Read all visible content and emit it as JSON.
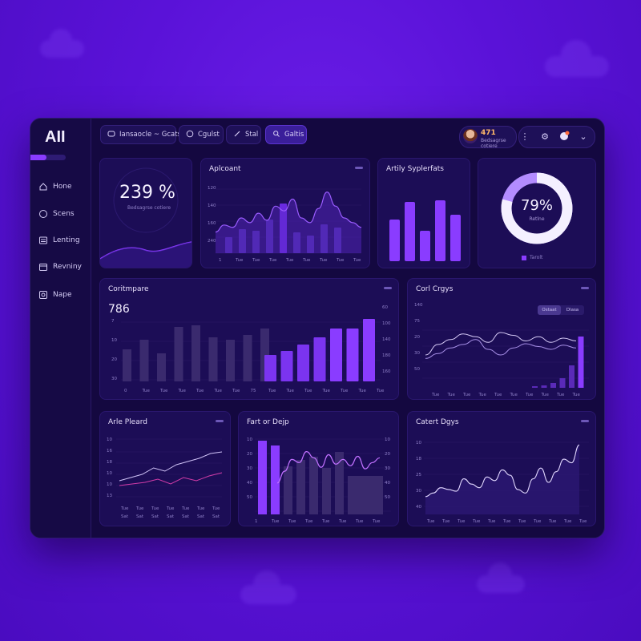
{
  "app": {
    "logo": "AII"
  },
  "sidebar": {
    "items": [
      {
        "label": "Hone",
        "icon": "home-icon"
      },
      {
        "label": "Scens",
        "icon": "chat-icon"
      },
      {
        "label": "Lenting",
        "icon": "list-icon"
      },
      {
        "label": "Revniny",
        "icon": "calendar-icon"
      },
      {
        "label": "Nape",
        "icon": "map-icon"
      }
    ]
  },
  "topbar": {
    "tabs": [
      {
        "label": "Iansaocle ~ Gcats",
        "icon": "layers-icon"
      },
      {
        "label": "Cgulst",
        "icon": "globe-icon"
      },
      {
        "label": "Stal",
        "icon": "pencil-icon"
      },
      {
        "label": "Galtis",
        "icon": "search-icon"
      }
    ],
    "profile": {
      "value": "471",
      "subtitle": "Bedsagrse cotiere"
    }
  },
  "cards": {
    "kpi": {
      "value": "239 %",
      "subtitle": "Bedsagrse cotiere"
    },
    "area": {
      "title": "Aplcoant"
    },
    "bars": {
      "title": "Artily Syplerfats"
    },
    "donut": {
      "value": "79%",
      "subtitle": "Retlne",
      "legend": "Tarolt"
    },
    "combo": {
      "title": "Coritmpare",
      "value": "786"
    },
    "lines": {
      "title": "Corl Crgys",
      "toggle": [
        "Ostaat",
        "Dlasa"
      ]
    },
    "small1": {
      "title": "Arle Pleard"
    },
    "small2": {
      "title": "Fart or Dejp"
    },
    "small3": {
      "title": "Catert Dgys"
    }
  },
  "colors": {
    "accent": "#8a3cff",
    "accent_light": "#b070ff",
    "bg": "#140840",
    "card": "#1c0d56",
    "muted_bar": "#3a2a6e"
  },
  "chart_data": [
    {
      "type": "area",
      "title": "Aplcoant",
      "x": [
        "1",
        "Tue",
        "Tue",
        "Tue",
        "Tue",
        "Tue",
        "Tue",
        "Tue",
        "Tue"
      ],
      "values": [
        18,
        24,
        22,
        30,
        26,
        34,
        28,
        40,
        36,
        46,
        30,
        26,
        38,
        52,
        40,
        30,
        26,
        22
      ],
      "bars": [
        20,
        30,
        28,
        42,
        62,
        26,
        22,
        36,
        32
      ],
      "yticks": [
        "120",
        "140",
        "160",
        "240"
      ]
    },
    {
      "type": "bar",
      "title": "Artily Syplerfats",
      "values": [
        52,
        74,
        38,
        76,
        58
      ]
    },
    {
      "type": "pie",
      "title": "79%",
      "values": [
        79,
        21
      ]
    },
    {
      "type": "bar",
      "title": "Coritmpare",
      "series": [
        {
          "values": [
            40,
            52,
            35,
            68,
            70,
            55,
            52,
            58,
            66
          ]
        },
        {
          "values": [
            33,
            38,
            46,
            55,
            66,
            66,
            78
          ]
        }
      ],
      "yticks": [
        "7",
        "10",
        "20",
        "30"
      ],
      "yticks_right": [
        "60",
        "100",
        "140",
        "180",
        "160"
      ]
    },
    {
      "type": "line",
      "title": "Corl Crgys",
      "series": [
        {
          "values": [
            40,
            55,
            62,
            70,
            66,
            58,
            72,
            68,
            60,
            66,
            58,
            64,
            60
          ]
        },
        {
          "values": [
            35,
            42,
            50,
            55,
            62,
            48,
            40,
            50,
            56,
            52,
            48,
            54,
            50
          ]
        }
      ],
      "bars": [
        2,
        3,
        6,
        12,
        28,
        64
      ],
      "yticks": [
        "140",
        "75",
        "20",
        "30",
        "50"
      ]
    },
    {
      "type": "line",
      "title": "Arle Pleard",
      "series": [
        {
          "values": [
            24,
            28,
            32,
            40,
            36,
            44,
            48,
            52,
            58,
            60
          ]
        },
        {
          "values": [
            18,
            20,
            22,
            26,
            20,
            28,
            24,
            30,
            34
          ]
        }
      ],
      "yticks": [
        "10",
        "16",
        "18",
        "10",
        "10",
        "13"
      ]
    },
    {
      "type": "bar",
      "title": "Fart or Dejp",
      "values": [
        92,
        86,
        60,
        68,
        72,
        58,
        78
      ],
      "line": [
        40,
        55,
        70,
        66,
        80,
        72,
        60,
        76,
        64,
        70,
        62,
        74,
        58,
        66,
        72
      ],
      "yticks": [
        "10",
        "20",
        "30",
        "40",
        "50"
      ]
    },
    {
      "type": "line",
      "title": "Catert Dgys",
      "values": [
        20,
        24,
        30,
        28,
        26,
        40,
        34,
        30,
        42,
        38,
        50,
        44,
        28,
        24,
        40,
        52,
        36,
        48,
        62,
        58,
        78
      ],
      "yticks": [
        "10",
        "18",
        "25",
        "30",
        "40"
      ]
    }
  ]
}
